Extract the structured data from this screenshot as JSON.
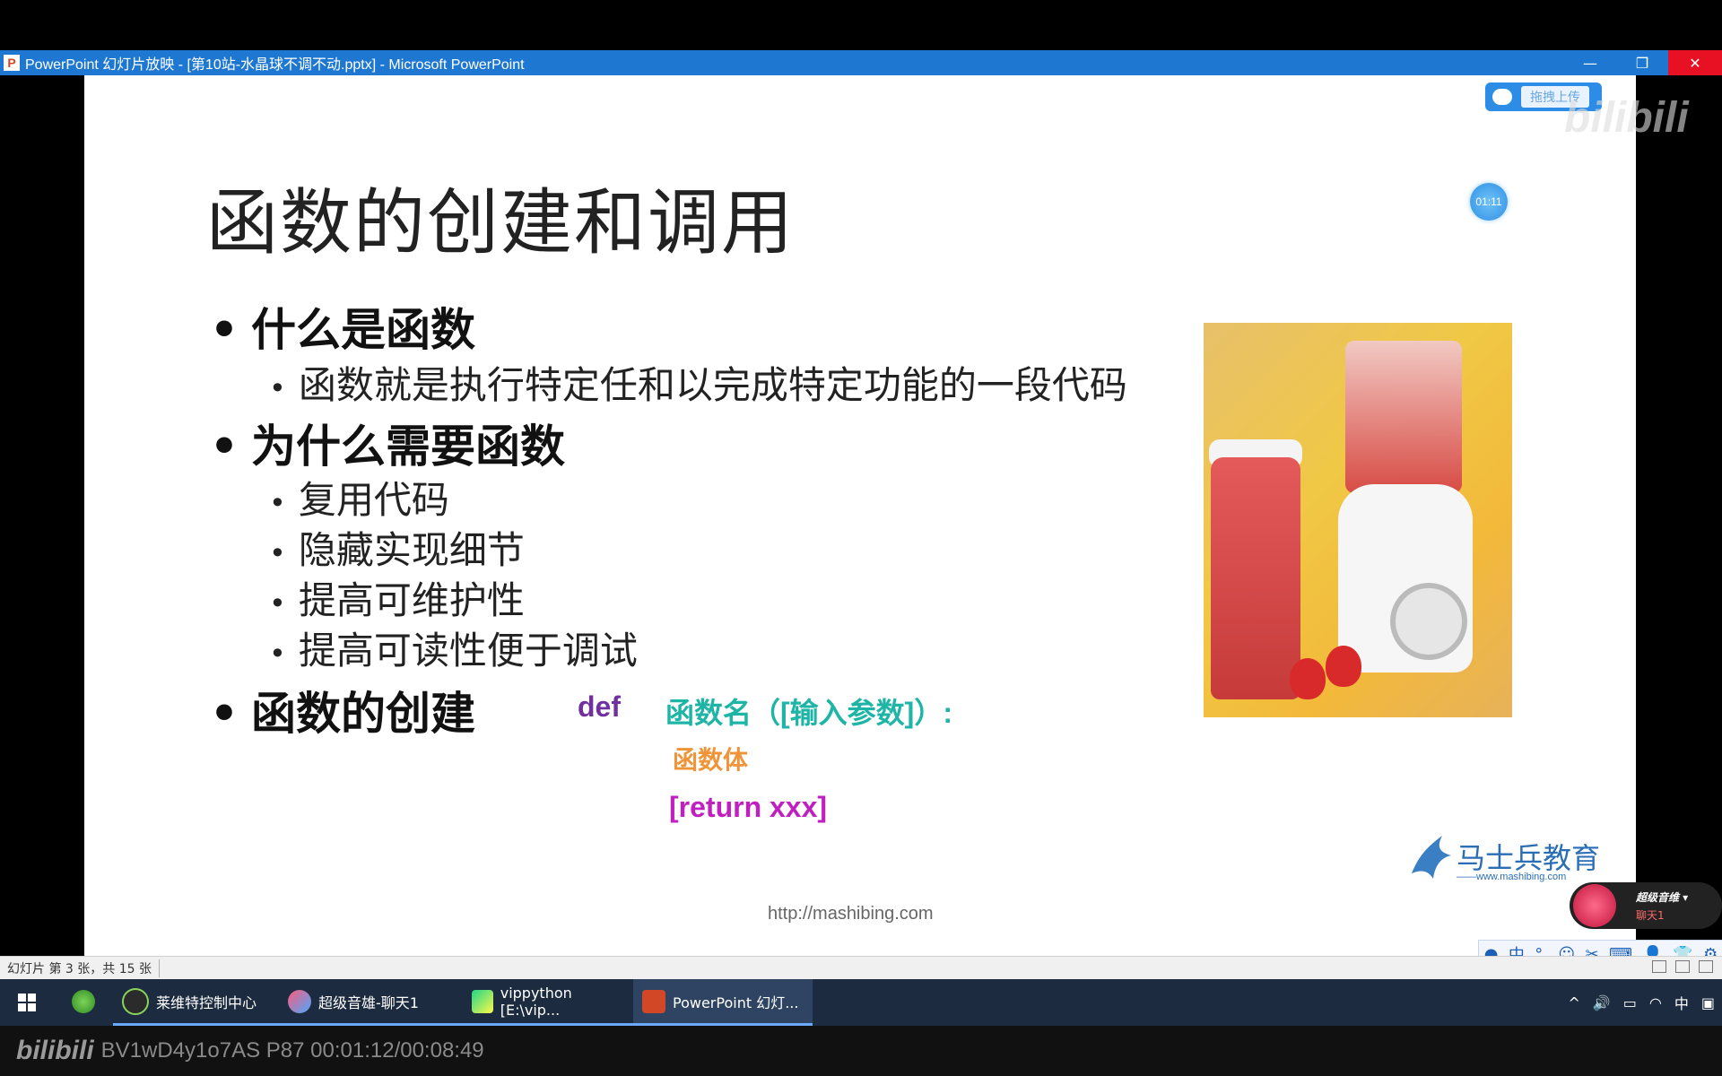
{
  "window": {
    "title": "PowerPoint 幻灯片放映 - [第10站-水晶球不调不动.pptx] - Microsoft PowerPoint",
    "app_icon": "P",
    "buttons": {
      "minimize": "—",
      "restore": "❐",
      "close": "✕"
    }
  },
  "slide": {
    "title": "函数的创建和调用",
    "bullets": [
      {
        "text": "什么是函数"
      },
      {
        "sub": "函数就是执行特定任和以完成特定功能的一段代码"
      },
      {
        "text": "为什么需要函数"
      },
      {
        "sub1": "复用代码",
        "sub2": "隐藏实现细节",
        "sub3": "提高可维护性",
        "sub4": "提高可读性便于调试"
      },
      {
        "text": "函数的创建"
      }
    ],
    "code": {
      "def": "def",
      "signature": "函数名（[输入参数]）:",
      "body": "函数体",
      "ret": "[return xxx]",
      "colors": {
        "def": "#7030a0",
        "signature": "#1fb5a6",
        "body": "#f0943a",
        "ret": "#c020c0"
      }
    },
    "url": "http://mashibing.com",
    "timer": "01:11",
    "upload_label": "拖拽上传",
    "watermark": "bilibili",
    "logo": {
      "name": "马士兵教育",
      "site": "——www.mashibing.com"
    }
  },
  "overlay": {
    "music_title": "超级音维 ▾",
    "music_sub": "聊天1"
  },
  "ime": {
    "mode": "中",
    "items": [
      "●",
      "中",
      "°,",
      "☺",
      "✂",
      "⌨",
      "👤",
      "👕",
      "⚙"
    ]
  },
  "statusbar": {
    "slide_info": "幻灯片 第 3 张，共 15 张"
  },
  "taskbar": {
    "items": [
      {
        "label": "莱维特控制中心"
      },
      {
        "label": "超级音雄-聊天1"
      },
      {
        "label": "vippython [E:\\vip..."
      },
      {
        "label": "PowerPoint 幻灯..."
      }
    ],
    "tray": {
      "caret": "^",
      "volume": "🔊",
      "battery": "▭",
      "network": "◠",
      "ime": "中",
      "notify": "▣"
    }
  },
  "bilibili_bar": {
    "brand": "bilibili",
    "info": "BV1wD4y1o7AS P87 00:01:12/00:08:49"
  }
}
